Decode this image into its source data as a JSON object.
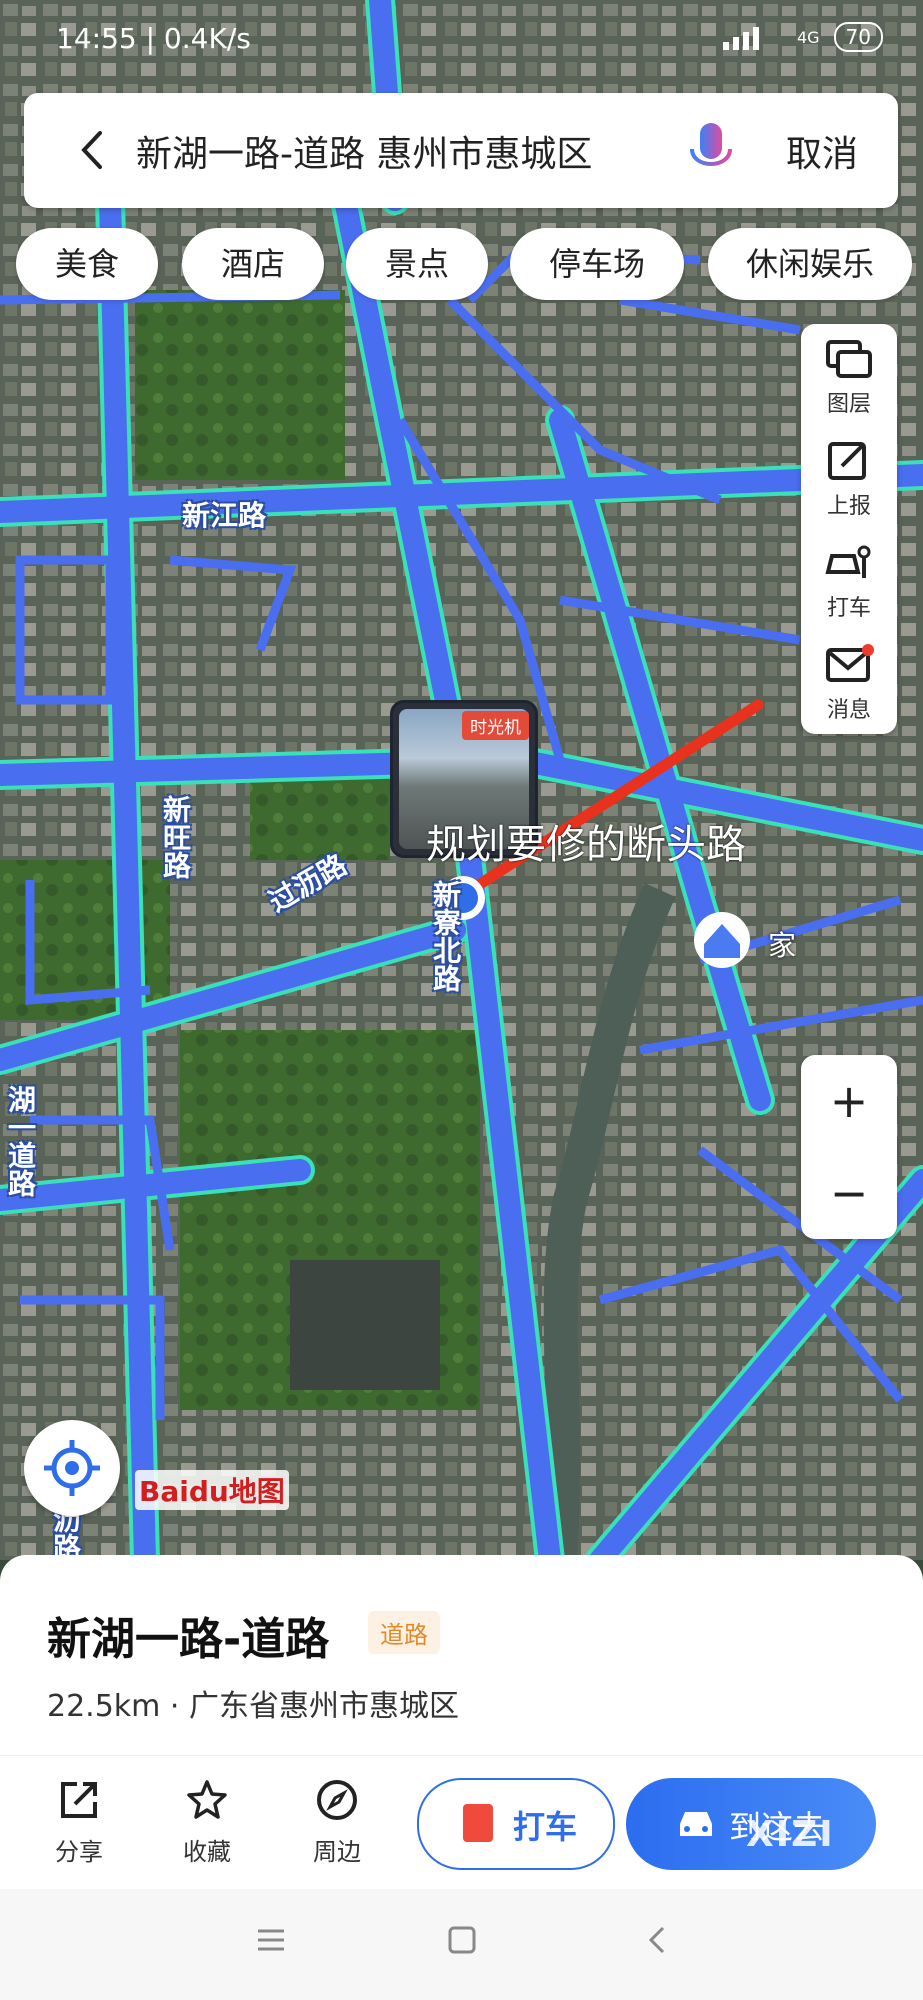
{
  "status_bar": {
    "time": "14:55 | 0.4K/s",
    "network": "4G",
    "battery": "70"
  },
  "search": {
    "query": "新湖一路-道路 惠州市惠城区",
    "cancel_label": "取消"
  },
  "categories": [
    "美食",
    "酒店",
    "景点",
    "停车场",
    "休闲娱乐"
  ],
  "map_tools": [
    {
      "label": "图层",
      "icon": "layers-icon"
    },
    {
      "label": "上报",
      "icon": "report-icon"
    },
    {
      "label": "打车",
      "icon": "taxi-icon"
    },
    {
      "label": "消息",
      "icon": "message-icon"
    }
  ],
  "map": {
    "time_machine_label": "时光机",
    "annotation": "规划要修的断头路",
    "home_label": "家",
    "logo_text": "Baidu地图",
    "road_labels": [
      "新江路",
      "新旺路",
      "过沥路",
      "新寮北路",
      "湖一道路",
      "沥路"
    ],
    "colors": {
      "road": "#4a6ef0",
      "road_edge": "#39e0b8",
      "annotation_line": "#e8321e"
    }
  },
  "place": {
    "title": "新湖一路-道路",
    "tag": "道路",
    "subtitle": "22.5km · 广东省惠州市惠城区"
  },
  "actions": [
    {
      "label": "分享",
      "icon": "share-icon"
    },
    {
      "label": "收藏",
      "icon": "star-icon"
    },
    {
      "label": "周边",
      "icon": "compass-icon"
    }
  ],
  "buttons": {
    "taxi": "打车",
    "navigate": "到这去"
  },
  "watermark": "XIZI",
  "accent_color": "#2f6ee8"
}
